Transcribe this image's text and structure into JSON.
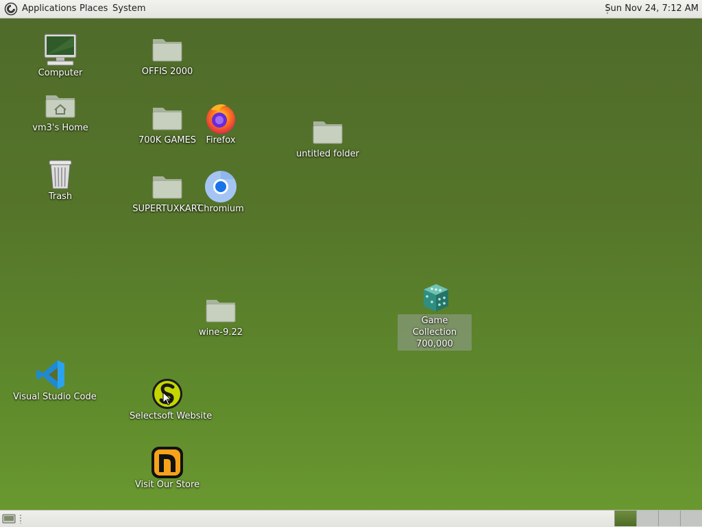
{
  "top_panel": {
    "menus": {
      "applications": "Applications",
      "places": "Places",
      "system": "System"
    },
    "clock": "Sun Nov 24,  7:12 AM"
  },
  "desktop": {
    "icons": [
      {
        "id": "computer",
        "label": "Computer",
        "icon": "computer-icon"
      },
      {
        "id": "home",
        "label": "vm3's Home",
        "icon": "home-folder-icon"
      },
      {
        "id": "trash",
        "label": "Trash",
        "icon": "trash-icon"
      },
      {
        "id": "offis",
        "label": "OFFIS 2000",
        "icon": "folder-icon"
      },
      {
        "id": "games700k",
        "label": "700K GAMES",
        "icon": "folder-icon"
      },
      {
        "id": "supertuxkart",
        "label": "SUPERTUXKART",
        "icon": "folder-icon"
      },
      {
        "id": "firefox",
        "label": "Firefox",
        "icon": "firefox-icon"
      },
      {
        "id": "chromium",
        "label": "Chromium",
        "icon": "chromium-icon"
      },
      {
        "id": "untitled",
        "label": "untitled folder",
        "icon": "folder-icon"
      },
      {
        "id": "wine",
        "label": "wine-9.22",
        "icon": "folder-icon"
      },
      {
        "id": "game_collection",
        "label": "Game Collection 700,000",
        "icon": "dice-icon",
        "selected": true
      },
      {
        "id": "vscode",
        "label": "Visual Studio Code",
        "icon": "vscode-icon"
      },
      {
        "id": "selectsoft",
        "label": "Selectsoft Website",
        "icon": "selectsoft-icon"
      },
      {
        "id": "store",
        "label": "Visit Our Store",
        "icon": "store-icon"
      }
    ]
  },
  "bottom_panel": {
    "workspaces": [
      "workspace-1",
      "workspace-2",
      "workspace-3",
      "workspace-4"
    ],
    "active_workspace": 1
  },
  "colors": {
    "desktop_top": "#4f6a2a",
    "desktop_bottom": "#6b9a30",
    "panel": "#ebebe8",
    "folder": "#c7cfbf"
  }
}
